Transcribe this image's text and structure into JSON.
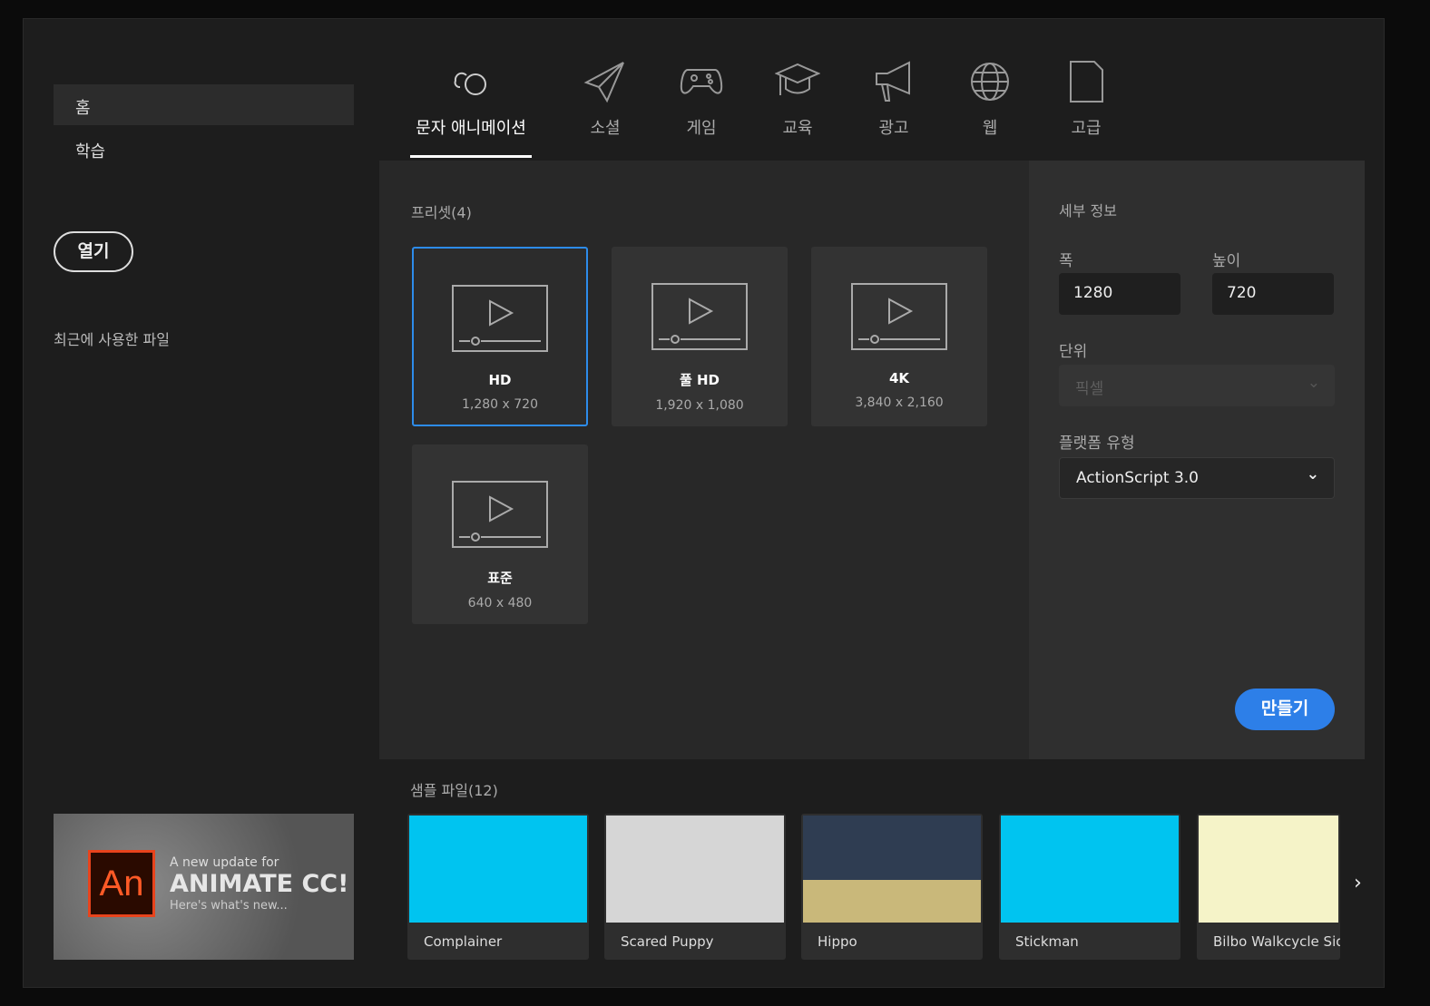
{
  "sidebar": {
    "items": [
      {
        "label": "홈"
      },
      {
        "label": "학습"
      }
    ],
    "open_label": "열기",
    "recent_label": "최근에 사용한 파일",
    "promo": {
      "logo": "An",
      "line1": "A new update for",
      "line2": "ANIMATE CC!",
      "line3": "Here's what's new..."
    }
  },
  "tabs": [
    {
      "label": "문자 애니메이션",
      "icon": "character-animation-icon"
    },
    {
      "label": "소셜",
      "icon": "paper-plane-icon"
    },
    {
      "label": "게임",
      "icon": "gamepad-icon"
    },
    {
      "label": "교육",
      "icon": "graduation-cap-icon"
    },
    {
      "label": "광고",
      "icon": "megaphone-icon"
    },
    {
      "label": "웹",
      "icon": "globe-icon"
    },
    {
      "label": "고급",
      "icon": "document-icon"
    }
  ],
  "presets": {
    "title": "프리셋(4)",
    "items": [
      {
        "name": "HD",
        "size": "1,280 x 720"
      },
      {
        "name": "풀 HD",
        "size": "1,920 x 1,080"
      },
      {
        "name": "4K",
        "size": "3,840 x 2,160"
      },
      {
        "name": "표준",
        "size": "640 x 480"
      }
    ]
  },
  "details": {
    "title": "세부 정보",
    "width_label": "폭",
    "width": "1280",
    "height_label": "높이",
    "height": "720",
    "unit_label": "단위",
    "unit": "픽셀",
    "platform_label": "플랫폼 유형",
    "platform": "ActionScript 3.0",
    "create": "만들기"
  },
  "samples": {
    "title": "샘플 파일(12)",
    "items": [
      {
        "name": "Complainer",
        "color": "#00c4f0"
      },
      {
        "name": "Scared Puppy",
        "color": "#d6d6d6"
      },
      {
        "name": "Hippo",
        "color": "#3a4a5e"
      },
      {
        "name": "Stickman",
        "color": "#00c4f0"
      },
      {
        "name": "Bilbo Walkcycle Side",
        "color": "#f5f3c8"
      }
    ]
  },
  "colors": {
    "accent": "#2d7fe8"
  }
}
